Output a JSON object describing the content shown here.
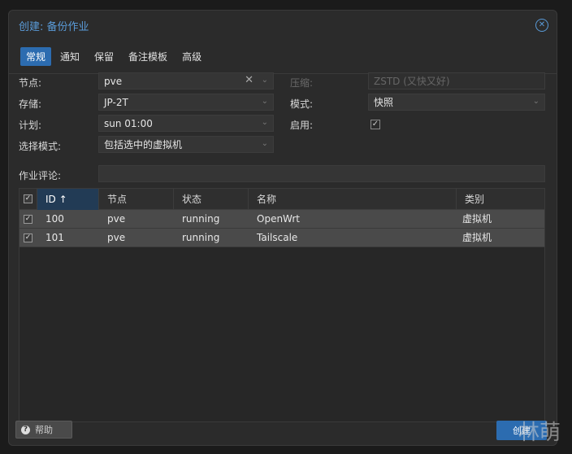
{
  "dialog": {
    "title": "创建: 备份作业",
    "close_icon": "close-circle-icon"
  },
  "tabs": [
    {
      "label": "常规",
      "active": true
    },
    {
      "label": "通知",
      "active": false
    },
    {
      "label": "保留",
      "active": false
    },
    {
      "label": "备注模板",
      "active": false
    },
    {
      "label": "高级",
      "active": false
    }
  ],
  "form": {
    "node_label": "节点:",
    "node_value": "pve",
    "storage_label": "存储:",
    "storage_value": "JP-2T",
    "schedule_label": "计划:",
    "schedule_value": "sun 01:00",
    "selection_label": "选择模式:",
    "selection_value": "包括选中的虚拟机",
    "compression_label": "压缩:",
    "compression_value": "ZSTD (又快又好)",
    "mode_label": "模式:",
    "mode_value": "快照",
    "enabled_label": "启用:",
    "enabled_checked": true,
    "comment_label": "作业评论:",
    "comment_value": ""
  },
  "grid": {
    "columns": [
      "ID ↑",
      "节点",
      "状态",
      "名称",
      "类别"
    ],
    "rows": [
      {
        "checked": true,
        "id": "100",
        "node": "pve",
        "status": "running",
        "name": "OpenWrt",
        "type": "虚拟机"
      },
      {
        "checked": true,
        "id": "101",
        "node": "pve",
        "status": "running",
        "name": "Tailscale",
        "type": "虚拟机"
      }
    ]
  },
  "footer": {
    "help_label": "帮助",
    "create_label": "创建"
  },
  "watermark": "林萌",
  "colors": {
    "accent": "#2c6cb0",
    "title": "#5a9bd8",
    "background": "#2b2b2b"
  }
}
